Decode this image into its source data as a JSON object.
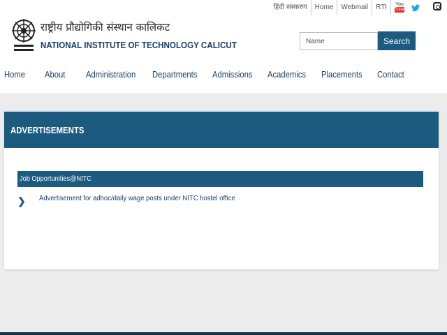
{
  "utility_links": {
    "hindi": "हिंदी संस्करण",
    "home": "Home",
    "webmail": "Webmail",
    "rti": "RTI"
  },
  "social": {
    "youtube_top": "You",
    "youtube_bottom": "Tube",
    "twitter_icon": "twitter-icon",
    "instagram_icon": "instagram-icon"
  },
  "branding": {
    "hindi_name": "राष्ट्रीय प्रौद्योगिकी संस्थान कालिकट",
    "english_name": "NATIONAL INSTITUTE OF TECHNOLOGY CALICUT"
  },
  "search": {
    "placeholder": "Name",
    "button_label": "Search"
  },
  "nav": {
    "items": [
      "Home",
      "About",
      "Administration",
      "Departments",
      "Admissions",
      "Academics",
      "Placements",
      "Contact"
    ]
  },
  "content": {
    "title": "ADVERTISEMENTS",
    "section_label": "Job Opportunities@NITC",
    "items": [
      "Advertisement for adhoc/daily wage posts under NITC hostel office"
    ]
  },
  "colors": {
    "primary": "#1c5a80",
    "nav_text": "#1b3f6a",
    "background": "#ececec"
  }
}
